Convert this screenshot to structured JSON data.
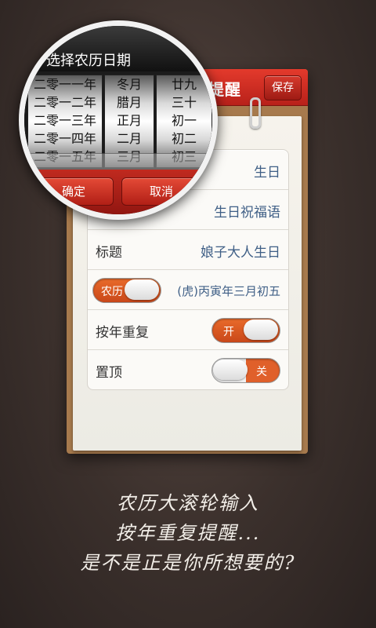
{
  "header": {
    "title": "福提醒",
    "save_label": "保存"
  },
  "form": {
    "type_value": "生日",
    "template_value": "生日祝福语",
    "title_label": "标题",
    "title_value": "娘子大人生日",
    "calendar_toggle_label": "农历",
    "calendar_value": "(虎)丙寅年三月初五",
    "repeat_label": "按年重复",
    "repeat_toggle_label": "开",
    "pin_label": "置顶",
    "pin_toggle_label": "关"
  },
  "picker": {
    "title": "选择农历日期",
    "years": [
      "二零一一年",
      "二零一二年",
      "二零一三年",
      "二零一四年",
      "二零一五年"
    ],
    "months": [
      "冬月",
      "腊月",
      "正月",
      "二月",
      "三月"
    ],
    "days": [
      "廿九",
      "三十",
      "初一",
      "初二",
      "初三"
    ],
    "confirm_label": "确定",
    "cancel_label": "取消"
  },
  "caption": {
    "line1": "农历大滚轮输入",
    "line2": "按年重复提醒...",
    "line3": "是不是正是你所想要的?"
  },
  "colors": {
    "accent_red": "#c8241a",
    "accent_orange": "#e0602a",
    "value_blue": "#3f5f86"
  }
}
